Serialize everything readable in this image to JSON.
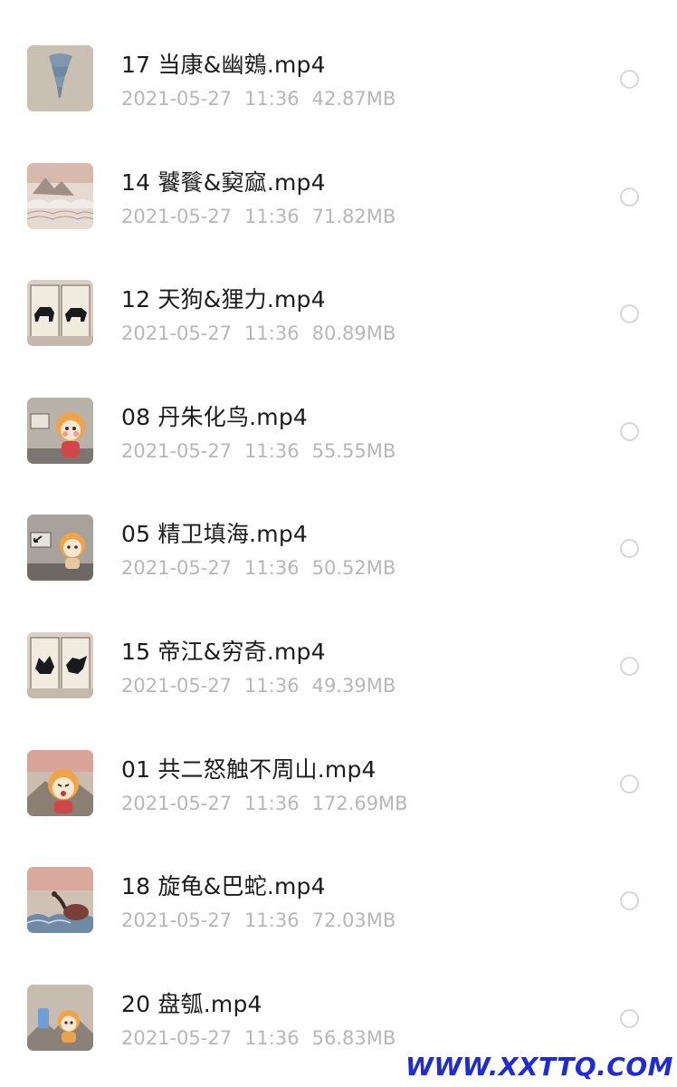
{
  "files": [
    {
      "title": "17 当康&幽鴳.mp4",
      "date": "2021-05-27",
      "time": "11:36",
      "size": "42.87MB",
      "thumb_icon": "tornado-thumbnail"
    },
    {
      "title": "14 饕餮&窫窳.mp4",
      "date": "2021-05-27",
      "time": "11:36",
      "size": "71.82MB",
      "thumb_icon": "clouds-landscape-thumbnail"
    },
    {
      "title": "12 天狗&狸力.mp4",
      "date": "2021-05-27",
      "time": "11:36",
      "size": "80.89MB",
      "thumb_icon": "book-silhouettes-thumbnail"
    },
    {
      "title": "08 丹朱化鸟.mp4",
      "date": "2021-05-27",
      "time": "11:36",
      "size": "55.55MB",
      "thumb_icon": "tiger-character-thumbnail"
    },
    {
      "title": "05 精卫填海.mp4",
      "date": "2021-05-27",
      "time": "11:36",
      "size": "50.52MB",
      "thumb_icon": "tiger-character-sign-thumbnail"
    },
    {
      "title": "15 帝江&穷奇.mp4",
      "date": "2021-05-27",
      "time": "11:36",
      "size": "49.39MB",
      "thumb_icon": "book-silhouettes-thumbnail"
    },
    {
      "title": "01 共二怒触不周山.mp4",
      "date": "2021-05-27",
      "time": "11:36",
      "size": "172.69MB",
      "thumb_icon": "tiger-character-angry-thumbnail"
    },
    {
      "title": "18 旋龟&巴蛇.mp4",
      "date": "2021-05-27",
      "time": "11:36",
      "size": "72.03MB",
      "thumb_icon": "turtle-snake-thumbnail"
    },
    {
      "title": "20 盘瓠.mp4",
      "date": "2021-05-27",
      "time": "11:36",
      "size": "56.83MB",
      "thumb_icon": "tiger-character-scene-thumbnail"
    }
  ],
  "watermark": "WWW.XXTTQ.COM"
}
